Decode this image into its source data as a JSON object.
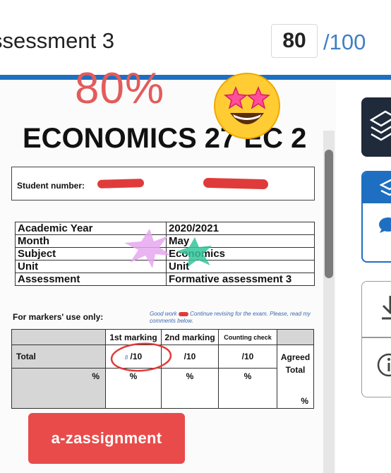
{
  "header": {
    "title": "ssessment 3",
    "score": "80",
    "score_total": "/100"
  },
  "annotations": {
    "percent": "80%",
    "emoji": "star-struck-emoji"
  },
  "document": {
    "title": "ECONOMICS 27 EC 2",
    "student_number_label": "Student number:",
    "info_rows": [
      {
        "label": "Academic Year",
        "value": "2020/2021"
      },
      {
        "label": "Month",
        "value": "May"
      },
      {
        "label": "Subject",
        "value": "Economics"
      },
      {
        "label": "Unit",
        "value": "Unit"
      },
      {
        "label": "Assessment",
        "value": "Formative assessment 3"
      }
    ],
    "markers_label": "For markers' use only:",
    "comment_start": "Good work",
    "comment_rest": "Continue revising for the exam. Please, read my comments below.",
    "marking": {
      "first_marking": "1st marking",
      "second_marking": "2nd marking",
      "counting_check": "Counting check",
      "total_label": "Total",
      "handwritten_score": "8",
      "out_of": "/10",
      "percent_sign": "%",
      "agreed_total": "Agreed Total"
    }
  },
  "button": {
    "label": "a-zassignment"
  },
  "colors": {
    "accent_blue": "#1e6fc1",
    "red": "#e45b5b",
    "button_red": "#e94b4b",
    "dark_panel": "#1f2a3a"
  },
  "icons": [
    "layers-icon",
    "comment-icon",
    "download-icon",
    "info-icon"
  ]
}
